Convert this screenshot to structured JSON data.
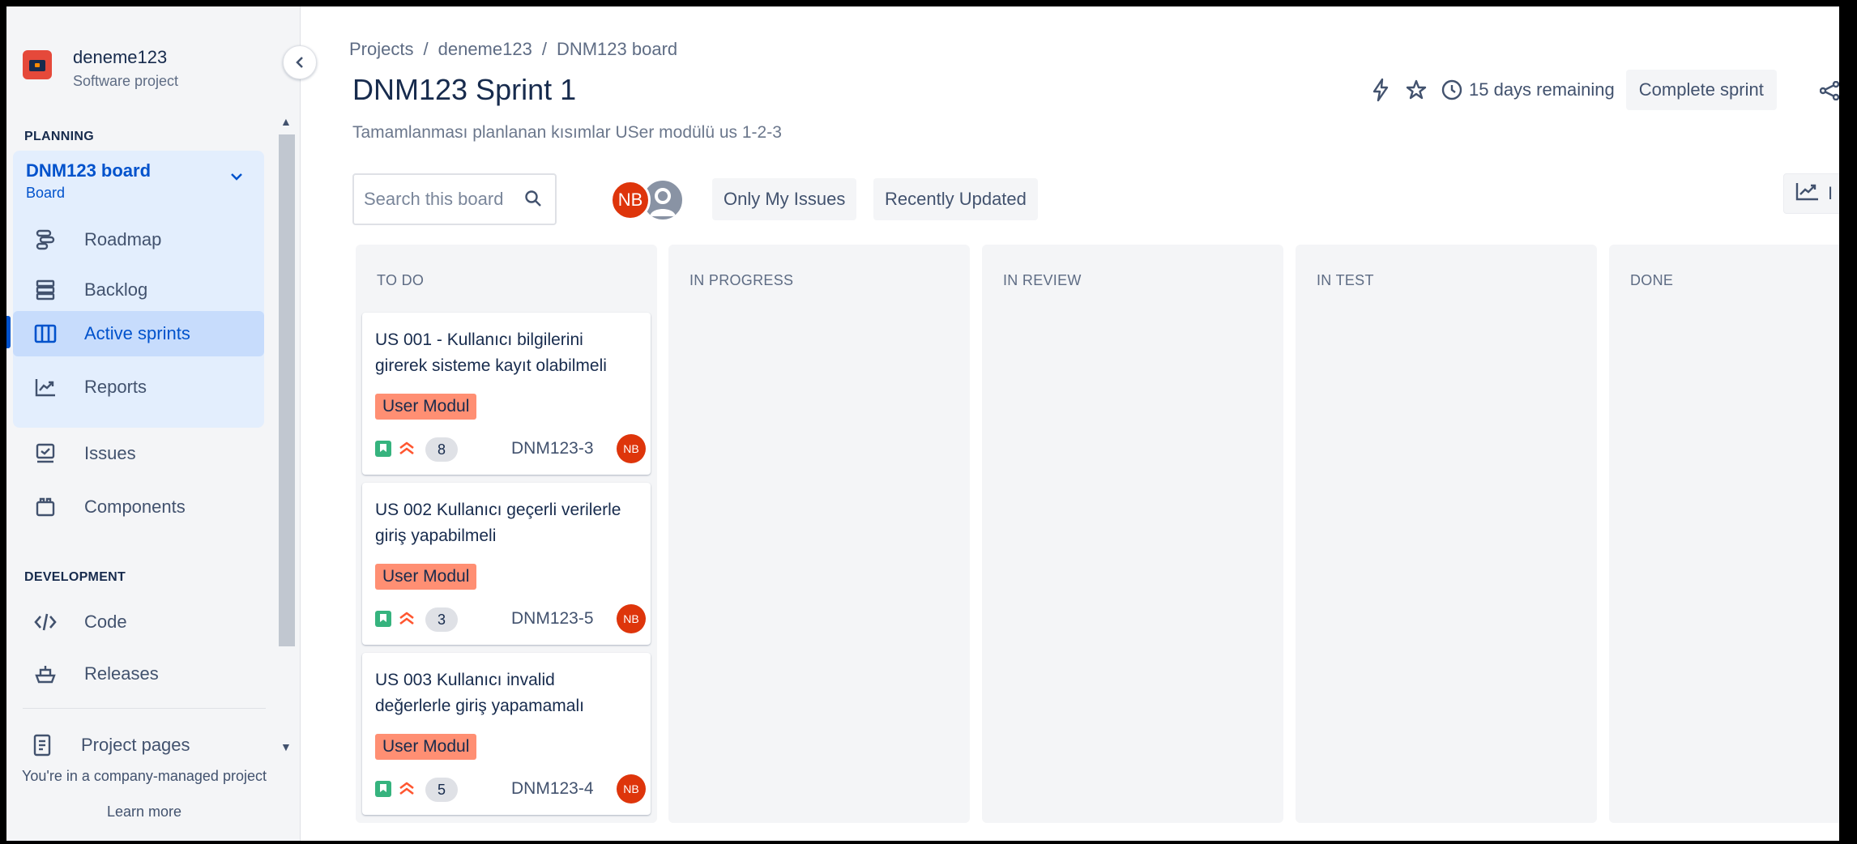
{
  "project": {
    "name": "deneme123",
    "type": "Software project"
  },
  "sidebar": {
    "planning_label": "PLANNING",
    "board": {
      "title": "DNM123 board",
      "subtitle": "Board"
    },
    "items": [
      {
        "label": "Roadmap",
        "icon": "roadmap-icon"
      },
      {
        "label": "Backlog",
        "icon": "backlog-icon"
      },
      {
        "label": "Active sprints",
        "icon": "active-sprints-icon"
      },
      {
        "label": "Reports",
        "icon": "reports-icon"
      },
      {
        "label": "Issues",
        "icon": "issues-icon"
      },
      {
        "label": "Components",
        "icon": "components-icon"
      }
    ],
    "development_label": "DEVELOPMENT",
    "dev_items": [
      {
        "label": "Code",
        "icon": "code-icon"
      },
      {
        "label": "Releases",
        "icon": "releases-icon"
      }
    ],
    "project_pages": "Project pages",
    "company_note": "You're in a company-managed project",
    "learn_more": "Learn more"
  },
  "breadcrumb": [
    "Projects",
    "deneme123",
    "DNM123 board"
  ],
  "sprint": {
    "title": "DNM123 Sprint 1",
    "goal": "Tamamlanması planlanan kısımlar USer modülü us 1-2-3",
    "days_remaining": "15 days remaining",
    "complete_label": "Complete sprint"
  },
  "filters": {
    "search_placeholder": "Search this board",
    "avatar_initials": "NB",
    "only_my_issues": "Only My Issues",
    "recently_updated": "Recently Updated",
    "insights_label": "I"
  },
  "columns": [
    {
      "name": "TO DO"
    },
    {
      "name": "IN PROGRESS"
    },
    {
      "name": "IN REVIEW"
    },
    {
      "name": "IN TEST"
    },
    {
      "name": "DONE"
    }
  ],
  "cards": [
    {
      "title": "US 001 - Kullanıcı bilgilerini girerek sisteme kayıt olabilmeli",
      "label": "User Modul",
      "points": "8",
      "key": "DNM123-3",
      "assignee": "NB"
    },
    {
      "title": "US 002 Kullanıcı geçerli verilerle giriş yapabilmeli",
      "label": "User Modul",
      "points": "3",
      "key": "DNM123-5",
      "assignee": "NB"
    },
    {
      "title": "US 003 Kullanıcı invalid değerlerle giriş yapamamalı",
      "label": "User Modul",
      "points": "5",
      "key": "DNM123-4",
      "assignee": "NB"
    }
  ],
  "colors": {
    "accent": "#0052cc",
    "label_bg": "#ff8f73",
    "avatar": "#de350b",
    "story": "#36b37e",
    "priority": "#ff5630"
  }
}
